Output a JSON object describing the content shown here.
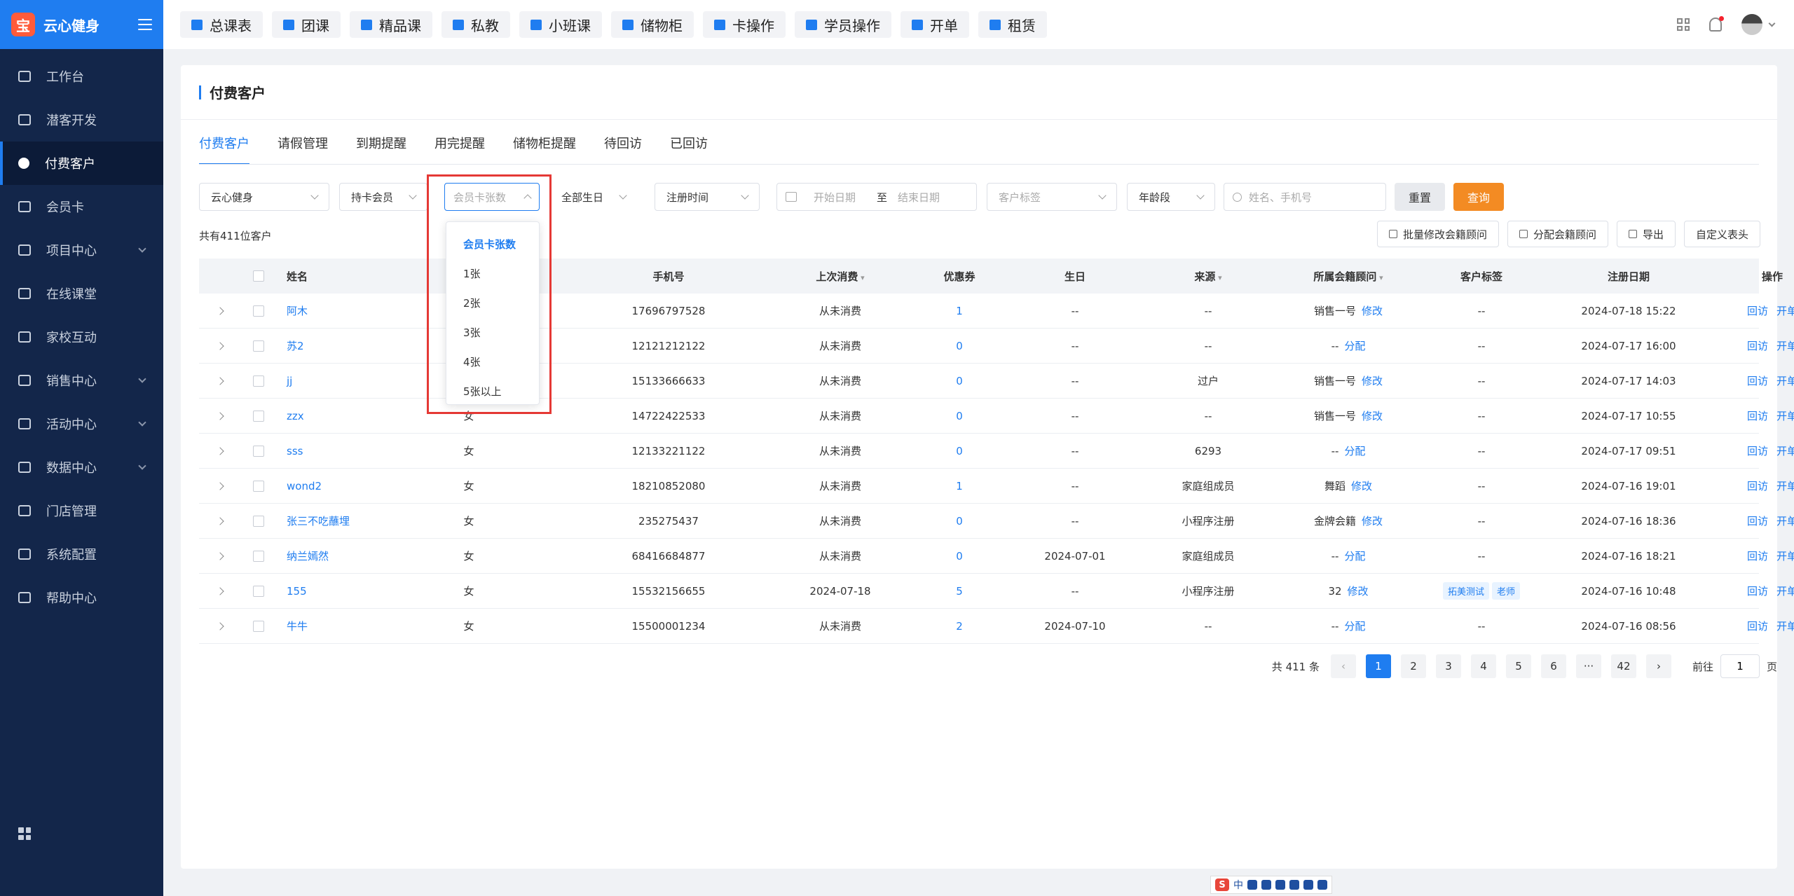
{
  "brand": {
    "logo_char": "宝",
    "name": "云心健身"
  },
  "sidebar": {
    "items": [
      {
        "label": "工作台",
        "icon": "image-icon",
        "expandable": false,
        "active": false
      },
      {
        "label": "潜客开发",
        "icon": "id-card-icon",
        "expandable": false,
        "active": false
      },
      {
        "label": "付费客户",
        "icon": "users-icon",
        "expandable": false,
        "active": true
      },
      {
        "label": "会员卡",
        "icon": "card-icon",
        "expandable": false,
        "active": false
      },
      {
        "label": "项目中心",
        "icon": "project-icon",
        "expandable": true,
        "active": false
      },
      {
        "label": "在线课堂",
        "icon": "classroom-icon",
        "expandable": false,
        "active": false
      },
      {
        "label": "家校互动",
        "icon": "interaction-icon",
        "expandable": false,
        "active": false
      },
      {
        "label": "销售中心",
        "icon": "tag-icon",
        "expandable": true,
        "active": false
      },
      {
        "label": "活动中心",
        "icon": "activity-icon",
        "expandable": true,
        "active": false
      },
      {
        "label": "数据中心",
        "icon": "pie-chart-icon",
        "expandable": true,
        "active": false
      },
      {
        "label": "门店管理",
        "icon": "store-icon",
        "expandable": false,
        "active": false
      },
      {
        "label": "系统配置",
        "icon": "monitor-icon",
        "expandable": false,
        "active": false
      },
      {
        "label": "帮助中心",
        "icon": "help-icon",
        "expandable": false,
        "active": false
      }
    ]
  },
  "topbar": {
    "buttons": [
      "总课表",
      "团课",
      "精品课",
      "私教",
      "小班课",
      "储物柜",
      "卡操作",
      "学员操作",
      "开单",
      "租赁"
    ]
  },
  "page": {
    "title": "付费客户",
    "tabs": [
      "付费客户",
      "请假管理",
      "到期提醒",
      "用完提醒",
      "储物柜提醒",
      "待回访",
      "已回访"
    ],
    "active_tab": 0
  },
  "filters": {
    "store": "云心健身",
    "member_type": "持卡会员",
    "card_count_placeholder": "会员卡张数",
    "birthday": "全部生日",
    "reg_time": "注册时间",
    "date_start": "开始日期",
    "date_to": "至",
    "date_end": "结束日期",
    "tag_placeholder": "客户标签",
    "age": "年龄段",
    "search_placeholder": "姓名、手机号",
    "reset": "重置",
    "query": "查询"
  },
  "summary": {
    "count_text": "共有411位客户"
  },
  "actions": [
    "批量修改会籍顾问",
    "分配会籍顾问",
    "导出",
    "自定义表头"
  ],
  "table": {
    "headers": {
      "name": "姓名",
      "phone": "手机号",
      "last_spend": "上次消费",
      "coupon": "优惠券",
      "birthday": "生日",
      "source": "来源",
      "advisor": "所属会籍顾问",
      "tags": "客户标签",
      "reg_date": "注册日期",
      "ops": "操作"
    },
    "rows": [
      {
        "name": "阿木",
        "gender": "",
        "phone": "17696797528",
        "last": "从未消费",
        "coupon": "1",
        "bday": "--",
        "src": "--",
        "adv": "销售一号",
        "adv_link": "修改",
        "tags": [],
        "tag_text": "--",
        "reg": "2024-07-18 15:22"
      },
      {
        "name": "苏2",
        "gender": "",
        "phone": "12121212122",
        "last": "从未消费",
        "coupon": "0",
        "bday": "--",
        "src": "--",
        "adv": "--",
        "adv_link": "分配",
        "tags": [],
        "tag_text": "--",
        "reg": "2024-07-17 16:00"
      },
      {
        "name": "jj",
        "gender": "",
        "phone": "15133666633",
        "last": "从未消费",
        "coupon": "0",
        "bday": "--",
        "src": "过户",
        "adv": "销售一号",
        "adv_link": "修改",
        "tags": [],
        "tag_text": "--",
        "reg": "2024-07-17 14:03"
      },
      {
        "name": "zzx",
        "gender": "女",
        "phone": "14722422533",
        "last": "从未消费",
        "coupon": "0",
        "bday": "--",
        "src": "--",
        "adv": "销售一号",
        "adv_link": "修改",
        "tags": [],
        "tag_text": "--",
        "reg": "2024-07-17 10:55"
      },
      {
        "name": "sss",
        "gender": "女",
        "phone": "12133221122",
        "last": "从未消费",
        "coupon": "0",
        "bday": "--",
        "src": "6293",
        "adv": "--",
        "adv_link": "分配",
        "tags": [],
        "tag_text": "--",
        "reg": "2024-07-17 09:51"
      },
      {
        "name": "wond2",
        "gender": "女",
        "phone": "18210852080",
        "last": "从未消费",
        "coupon": "1",
        "bday": "--",
        "src": "家庭组成员",
        "adv": "舞蹈",
        "adv_link": "修改",
        "tags": [],
        "tag_text": "--",
        "reg": "2024-07-16 19:01"
      },
      {
        "name": "张三不吃蘸埋",
        "gender": "女",
        "phone": "235275437",
        "last": "从未消费",
        "coupon": "0",
        "bday": "--",
        "src": "小程序注册",
        "adv": "金牌会籍",
        "adv_link": "修改",
        "tags": [],
        "tag_text": "--",
        "reg": "2024-07-16 18:36"
      },
      {
        "name": "纳兰嫣然",
        "gender": "女",
        "phone": "68416684877",
        "last": "从未消费",
        "coupon": "0",
        "bday": "2024-07-01",
        "src": "家庭组成员",
        "adv": "--",
        "adv_link": "分配",
        "tags": [],
        "tag_text": "--",
        "reg": "2024-07-16 18:21"
      },
      {
        "name": "155",
        "gender": "女",
        "phone": "15532156655",
        "last": "2024-07-18",
        "coupon": "5",
        "bday": "--",
        "src": "小程序注册",
        "adv": "32",
        "adv_link": "修改",
        "tags": [
          "拓美测试",
          "老师"
        ],
        "tag_text": "",
        "reg": "2024-07-16 10:48"
      },
      {
        "name": "牛牛",
        "gender": "女",
        "phone": "15500001234",
        "last": "从未消费",
        "coupon": "2",
        "bday": "2024-07-10",
        "src": "--",
        "adv": "--",
        "adv_link": "分配",
        "tags": [],
        "tag_text": "--",
        "reg": "2024-07-16 08:56"
      }
    ],
    "op_labels": [
      "回访",
      "开单"
    ]
  },
  "pagination": {
    "total_text": "共 411 条",
    "pages": [
      "1",
      "2",
      "3",
      "4",
      "5",
      "6",
      "···",
      "42"
    ],
    "current": "1",
    "goto_label": "前往",
    "goto_value": "1",
    "page_suffix": "页"
  },
  "dropdown": {
    "title": "会员卡张数",
    "options": [
      "会员卡张数",
      "1张",
      "2张",
      "3张",
      "4张",
      "5张以上"
    ],
    "selected": "会员卡张数"
  },
  "ime": {
    "logo": "S",
    "mode": "中"
  },
  "colors": {
    "primary": "#1f7df0",
    "sidebar": "#13264a",
    "query_button": "#f38b23",
    "highlight": "#e53935"
  }
}
